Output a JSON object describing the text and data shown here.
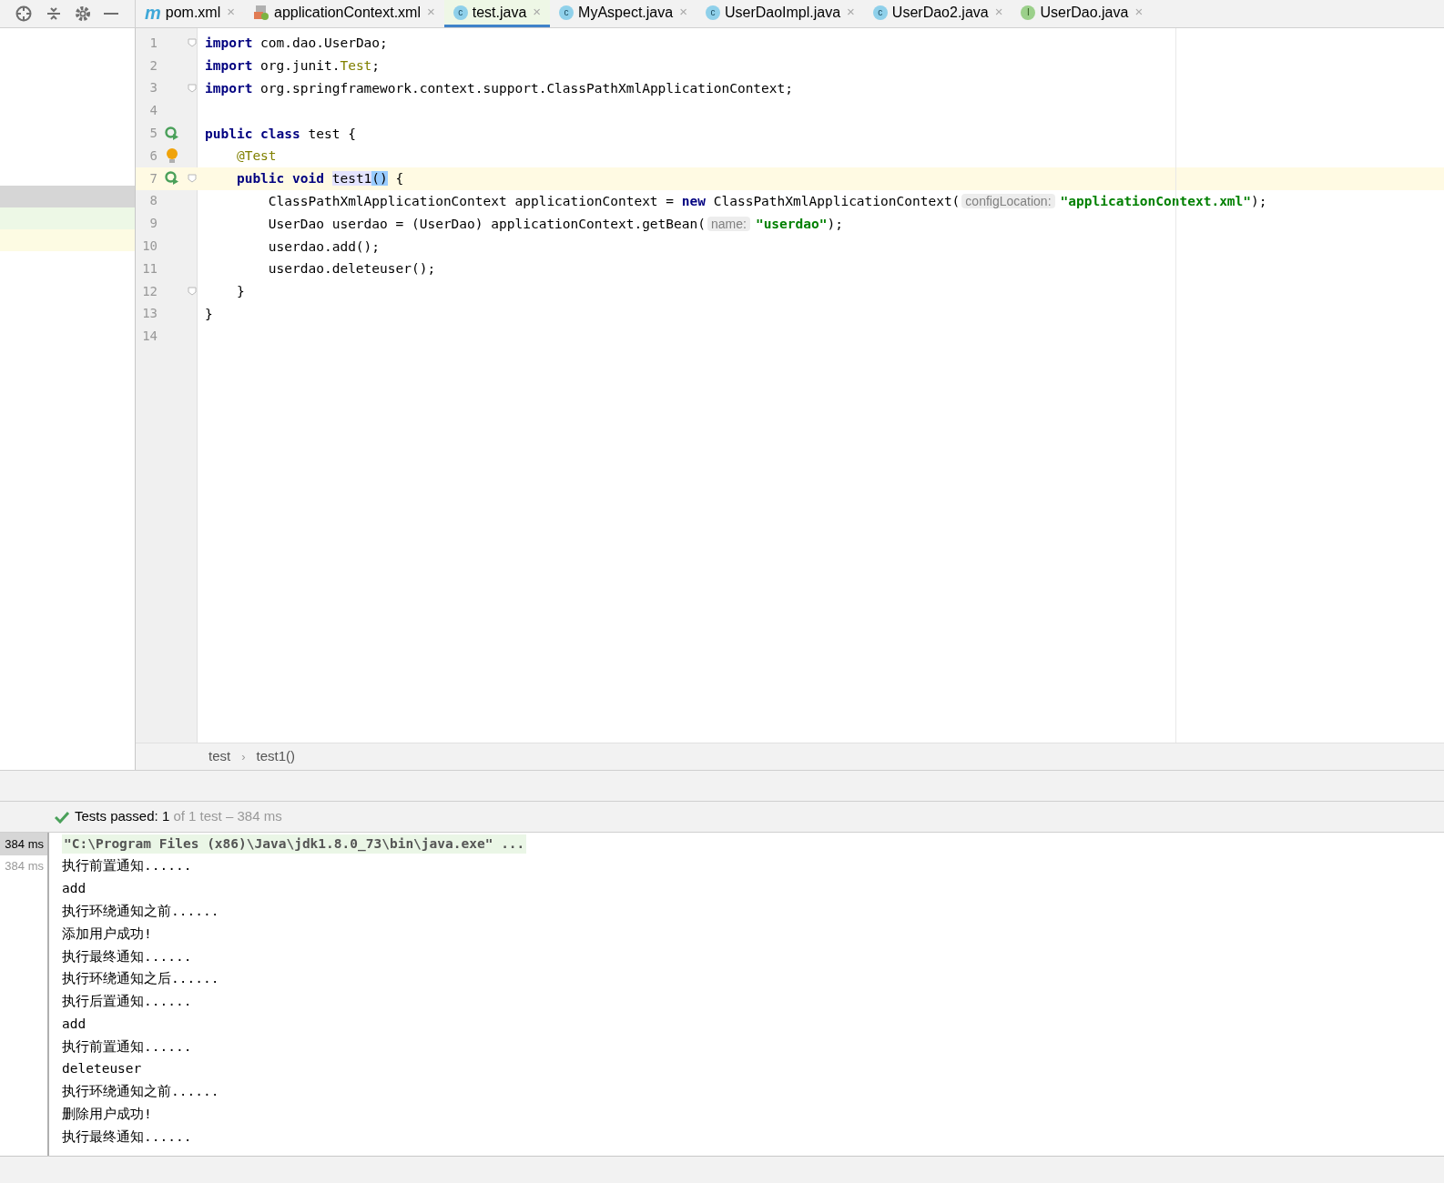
{
  "tabs": [
    {
      "label": "pom.xml",
      "kind": "maven",
      "icon_letter": "m",
      "close": "×",
      "selected": false
    },
    {
      "label": "applicationContext.xml",
      "kind": "xml",
      "close": "×",
      "selected": false
    },
    {
      "label": "test.java",
      "kind": "class",
      "icon_letter": "c",
      "close": "×",
      "selected": true
    },
    {
      "label": "MyAspect.java",
      "kind": "class",
      "icon_letter": "c",
      "close": "×",
      "selected": false
    },
    {
      "label": "UserDaoImpl.java",
      "kind": "class",
      "icon_letter": "c",
      "close": "×",
      "selected": false
    },
    {
      "label": "UserDao2.java",
      "kind": "class",
      "icon_letter": "c",
      "close": "×",
      "selected": false
    },
    {
      "label": "UserDao.java",
      "kind": "interface",
      "icon_letter": "I",
      "close": "×",
      "selected": false
    }
  ],
  "editor": {
    "lines": [
      {
        "number": "1",
        "fold": true,
        "highlighted": false,
        "tokens": [
          {
            "kind": "kw",
            "text": "import"
          },
          {
            "kind": "plain",
            "text": " com.dao.UserDao;"
          }
        ]
      },
      {
        "number": "2",
        "highlighted": false,
        "tokens": [
          {
            "kind": "kw",
            "text": "import"
          },
          {
            "kind": "plain",
            "text": " org.junit."
          },
          {
            "kind": "type",
            "text": "Test"
          },
          {
            "kind": "plain",
            "text": ";"
          }
        ]
      },
      {
        "number": "3",
        "fold": true,
        "highlighted": false,
        "tokens": [
          {
            "kind": "kw",
            "text": "import"
          },
          {
            "kind": "plain",
            "text": " org.springframework.context.support.ClassPathXmlApplicationContext;"
          }
        ]
      },
      {
        "number": "4",
        "highlighted": false
      },
      {
        "number": "5",
        "run": true,
        "highlighted": false,
        "tokens": [
          {
            "kind": "kw",
            "text": "public class"
          },
          {
            "kind": "plain",
            "text": " test {"
          }
        ]
      },
      {
        "number": "6",
        "bulb": true,
        "highlighted": false,
        "tokens": [
          {
            "kind": "ann",
            "text": "    @Test"
          }
        ]
      },
      {
        "number": "7",
        "run": true,
        "fold": true,
        "highlighted": true,
        "tokens": [
          {
            "kind": "kw",
            "text": "    public void "
          },
          {
            "kind": "sel",
            "text": "test1"
          },
          {
            "kind": "brace",
            "text": "("
          },
          {
            "kind": "brace",
            "text": ")"
          },
          {
            "kind": "plain",
            "text": " {"
          }
        ]
      },
      {
        "number": "8",
        "highlighted": false,
        "tokens": [
          {
            "kind": "plain",
            "text": "        ClassPathXmlApplicationContext applicationContext = "
          },
          {
            "kind": "kw",
            "text": "new"
          },
          {
            "kind": "plain",
            "text": " ClassPathXmlApplicationContext("
          },
          {
            "kind": "hint",
            "text": "configLocation:"
          },
          {
            "kind": "str",
            "text": "\"applicationContext.xml\""
          },
          {
            "kind": "plain",
            "text": ");"
          }
        ]
      },
      {
        "number": "9",
        "highlighted": false,
        "tokens": [
          {
            "kind": "plain",
            "text": "        UserDao userdao = (UserDao) applicationContext.getBean("
          },
          {
            "kind": "hint",
            "text": "name:"
          },
          {
            "kind": "str",
            "text": "\"userdao\""
          },
          {
            "kind": "plain",
            "text": ");"
          }
        ]
      },
      {
        "number": "10",
        "highlighted": false,
        "tokens": [
          {
            "kind": "plain",
            "text": "        userdao.add();"
          }
        ]
      },
      {
        "number": "11",
        "highlighted": false,
        "tokens": [
          {
            "kind": "plain",
            "text": "        userdao.deleteuser();"
          }
        ]
      },
      {
        "number": "12",
        "fold": true,
        "highlighted": false,
        "tokens": [
          {
            "kind": "plain",
            "text": "    }"
          }
        ]
      },
      {
        "number": "13",
        "highlighted": false,
        "tokens": [
          {
            "kind": "plain",
            "text": "}"
          }
        ]
      },
      {
        "number": "14",
        "highlighted": false
      }
    ],
    "breadcrumbs": [
      "test",
      "test1()"
    ],
    "breadcrumb_separator": "›"
  },
  "test_status": {
    "label": "Tests passed:",
    "count": "1",
    "detail": "of 1 test – 384 ms"
  },
  "console": {
    "timings": [
      {
        "text": "384 ms",
        "selected": true
      },
      {
        "text": "384 ms",
        "selected": false
      }
    ],
    "lines": [
      {
        "kind": "command",
        "text": "\"C:\\Program Files (x86)\\Java\\jdk1.8.0_73\\bin\\java.exe\" ..."
      },
      {
        "kind": "output",
        "text": "执行前置通知......"
      },
      {
        "kind": "output",
        "text": "add"
      },
      {
        "kind": "output",
        "text": "执行环绕通知之前......"
      },
      {
        "kind": "output",
        "text": "添加用户成功!"
      },
      {
        "kind": "output",
        "text": "执行最终通知......"
      },
      {
        "kind": "output",
        "text": "执行环绕通知之后......"
      },
      {
        "kind": "output",
        "text": "执行后置通知......"
      },
      {
        "kind": "output",
        "text": "add"
      },
      {
        "kind": "output",
        "text": "执行前置通知......"
      },
      {
        "kind": "output",
        "text": "deleteuser"
      },
      {
        "kind": "output",
        "text": "执行环绕通知之前......"
      },
      {
        "kind": "output",
        "text": "删除用户成功!"
      },
      {
        "kind": "output",
        "text": "执行最终通知......"
      }
    ]
  }
}
